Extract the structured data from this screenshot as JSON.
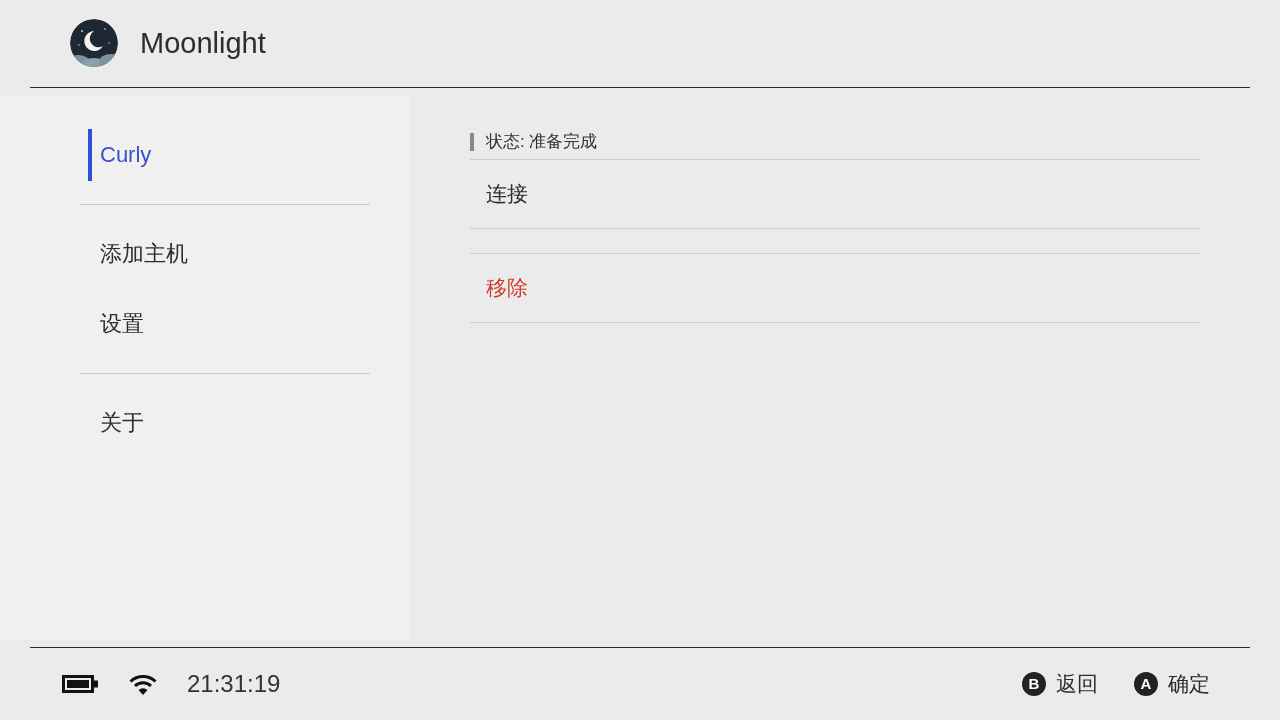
{
  "header": {
    "title": "Moonlight"
  },
  "sidebar": {
    "sections": [
      {
        "items": [
          {
            "label": "Curly",
            "selected": true
          }
        ]
      },
      {
        "items": [
          {
            "label": "添加主机",
            "selected": false
          },
          {
            "label": "设置",
            "selected": false
          }
        ]
      },
      {
        "items": [
          {
            "label": "关于",
            "selected": false
          }
        ]
      }
    ]
  },
  "content": {
    "status": "状态: 准备完成",
    "actions": [
      {
        "label": "连接",
        "kind": "default"
      },
      {
        "label": "移除",
        "kind": "danger"
      }
    ]
  },
  "footer": {
    "time": "21:31:19",
    "hints": [
      {
        "key": "B",
        "label": "返回"
      },
      {
        "key": "A",
        "label": "确定"
      }
    ]
  }
}
